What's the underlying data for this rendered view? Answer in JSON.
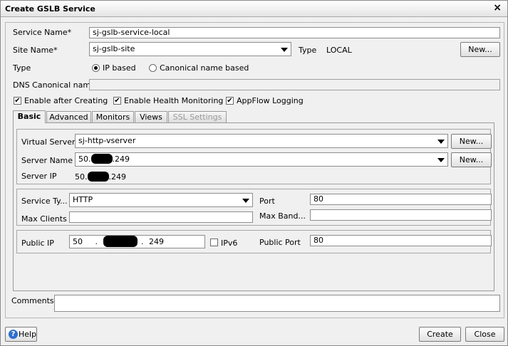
{
  "window": {
    "title": "Create GSLB Service",
    "close_glyph": "×"
  },
  "form": {
    "service_name_label": "Service Name*",
    "service_name_value": "sj-gslb-service-local",
    "site_name_label": "Site Name*",
    "site_name_value": "sj-gslb-site",
    "type_label_right": "Type",
    "type_value_right": "LOCAL",
    "new_button": "New...",
    "type_label": "Type",
    "radio_ip": "IP based",
    "radio_canonical": "Canonical name based",
    "dns_label": "DNS Canonical name",
    "dns_value": "",
    "check_enable_after": "Enable after Creating",
    "check_health": "Enable Health Monitoring",
    "check_appflow": "AppFlow Logging"
  },
  "tabs": [
    {
      "label": "Basic"
    },
    {
      "label": "Advanced"
    },
    {
      "label": "Monitors"
    },
    {
      "label": "Views"
    },
    {
      "label": "SSL Settings"
    }
  ],
  "basic": {
    "virtual_server_label": "Virtual Server",
    "virtual_server_value": "sj-http-vserver",
    "server_name_label": "Server Name",
    "server_name_prefix": "50.",
    "server_name_suffix": ".249",
    "server_ip_label": "Server IP",
    "server_ip_prefix": "50.",
    "server_ip_suffix": ".249",
    "new_button": "New...",
    "service_type_label": "Service Ty...",
    "service_type_value": "HTTP",
    "port_label": "Port",
    "port_value": "80",
    "max_clients_label": "Max Clients",
    "max_clients_value": "",
    "max_band_label": "Max Band...",
    "max_band_value": "",
    "public_ip_label": "Public IP",
    "public_ip_octet1": "50",
    "public_ip_dot": ".",
    "public_ip_octet4": "249",
    "ipv6_label": "IPv6",
    "public_port_label": "Public Port",
    "public_port_value": "80"
  },
  "comments": {
    "label": "Comments",
    "value": ""
  },
  "footer": {
    "help": "Help",
    "create": "Create",
    "close": "Close"
  }
}
